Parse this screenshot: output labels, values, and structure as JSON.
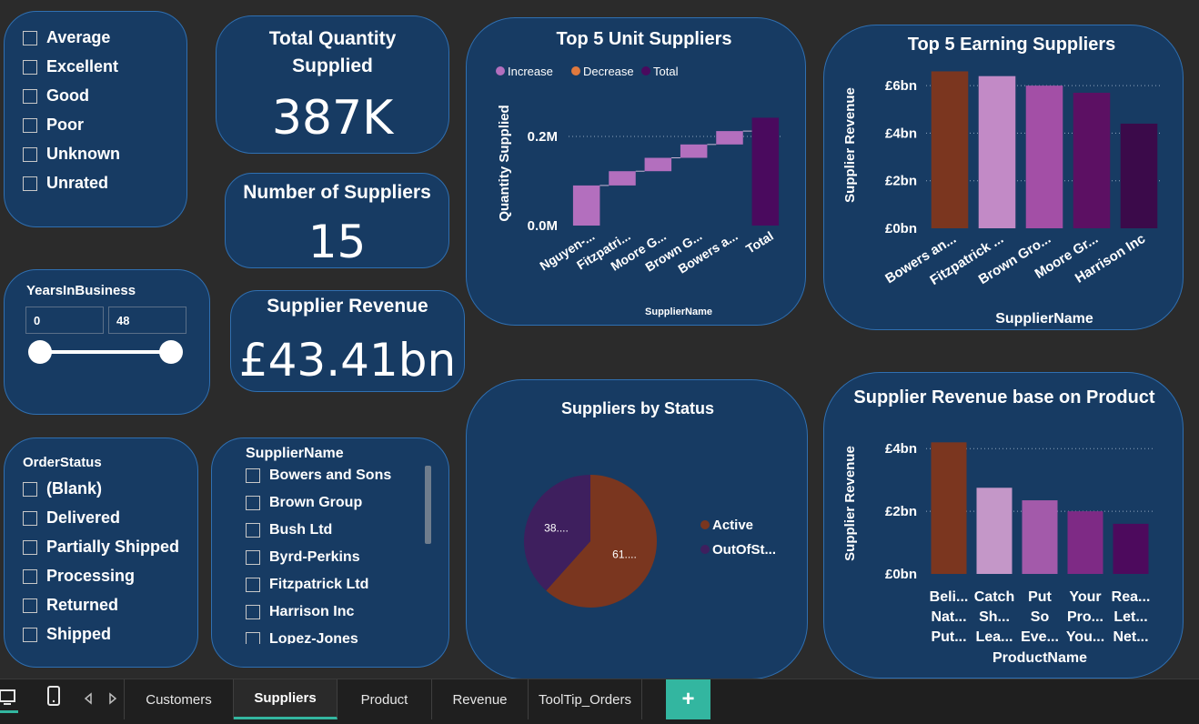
{
  "rating_slicer": {
    "items": [
      "Average",
      "Excellent",
      "Good",
      "Poor",
      "Unknown",
      "Unrated"
    ]
  },
  "kpi_quantity": {
    "title": "Total Quantity Supplied",
    "value": "387K"
  },
  "kpi_suppliers": {
    "title": "Number of Suppliers",
    "value": "15"
  },
  "kpi_revenue": {
    "title": "Supplier Revenue",
    "value": "£43.41bn"
  },
  "years_slicer": {
    "title": "YearsInBusiness",
    "min": "0",
    "max": "48"
  },
  "order_status_slicer": {
    "title": "OrderStatus",
    "items": [
      "(Blank)",
      "Delivered",
      "Partially Shipped",
      "Processing",
      "Returned",
      "Shipped"
    ]
  },
  "supplier_name_slicer": {
    "title": "SupplierName",
    "items": [
      "Bowers and Sons",
      "Brown Group",
      "Bush Ltd",
      "Byrd-Perkins",
      "Fitzpatrick Ltd",
      "Harrison Inc",
      "Lopez-Jones"
    ]
  },
  "tabs": {
    "items": [
      "Customers",
      "Suppliers",
      "Product",
      "Revenue",
      "ToolTip_Orders"
    ],
    "active": "Suppliers",
    "add": "+"
  },
  "colors": {
    "background": "#2b2b2b",
    "card": "#173b63",
    "card_border": "#2f6fb1",
    "accent_tab": "#33b6a0"
  },
  "chart_data": [
    {
      "id": "waterfall",
      "type": "bar",
      "subtype": "waterfall",
      "title": "Top 5 Unit Suppliers",
      "xlabel": "SupplierName",
      "ylabel": "Quantity Supplied",
      "legend": [
        "Increase",
        "Decrease",
        "Total"
      ],
      "legend_colors": [
        "#b36fbe",
        "#e0793e",
        "#4a0a5e"
      ],
      "categories": [
        "Nguyen-...",
        "Fitzpatri...",
        "Moore G...",
        "Brown G...",
        "Bowers a...",
        "Total"
      ],
      "values": [
        0.09,
        0.032,
        0.03,
        0.03,
        0.03,
        0.242
      ],
      "ylim": [
        0,
        0.3
      ],
      "yticks": [
        "0.0M",
        "0.2M"
      ],
      "ytick_values": [
        0,
        0.2
      ]
    },
    {
      "id": "earning",
      "type": "bar",
      "title": "Top 5 Earning Suppliers",
      "xlabel": "SupplierName",
      "ylabel": "Supplier Revenue",
      "categories": [
        "Bowers an...",
        "Fitzpatrick ...",
        "Brown Gro...",
        "Moore Gr...",
        "Harrison Inc"
      ],
      "values": [
        6.6,
        6.4,
        6.0,
        5.7,
        4.4
      ],
      "colors": [
        "#7b361f",
        "#c28ac6",
        "#a34fa6",
        "#5c1063",
        "#3b0a4a"
      ],
      "ylim": [
        0,
        7
      ],
      "yticks": [
        "£0bn",
        "£2bn",
        "£4bn",
        "£6bn"
      ],
      "ytick_values": [
        0,
        2,
        4,
        6
      ]
    },
    {
      "id": "status",
      "type": "pie",
      "title": "Suppliers by Status",
      "labels": [
        "Active",
        "OutOfSt..."
      ],
      "slice_labels": [
        "61....",
        "38...."
      ],
      "values": [
        61,
        38
      ],
      "colors": [
        "#7a361f",
        "#3e1f5e"
      ]
    },
    {
      "id": "product",
      "type": "bar",
      "title": "Supplier Revenue base on Product",
      "xlabel": "ProductName",
      "ylabel": "Supplier Revenue",
      "categories": [
        [
          "Beli...",
          "Nat...",
          "Put..."
        ],
        [
          "Catch",
          "Sh...",
          "Lea..."
        ],
        [
          "Put",
          "So",
          "Eve..."
        ],
        [
          "Your",
          "Pro...",
          "You..."
        ],
        [
          "Rea...",
          "Let...",
          "Net..."
        ]
      ],
      "values": [
        4.2,
        2.75,
        2.35,
        2.0,
        1.6
      ],
      "colors": [
        "#7b361f",
        "#c497c8",
        "#a35aaa",
        "#7e2a85",
        "#4d0a5d"
      ],
      "ylim": [
        0,
        4.5
      ],
      "yticks": [
        "£0bn",
        "£2bn",
        "£4bn"
      ],
      "ytick_values": [
        0,
        2,
        4
      ]
    }
  ]
}
